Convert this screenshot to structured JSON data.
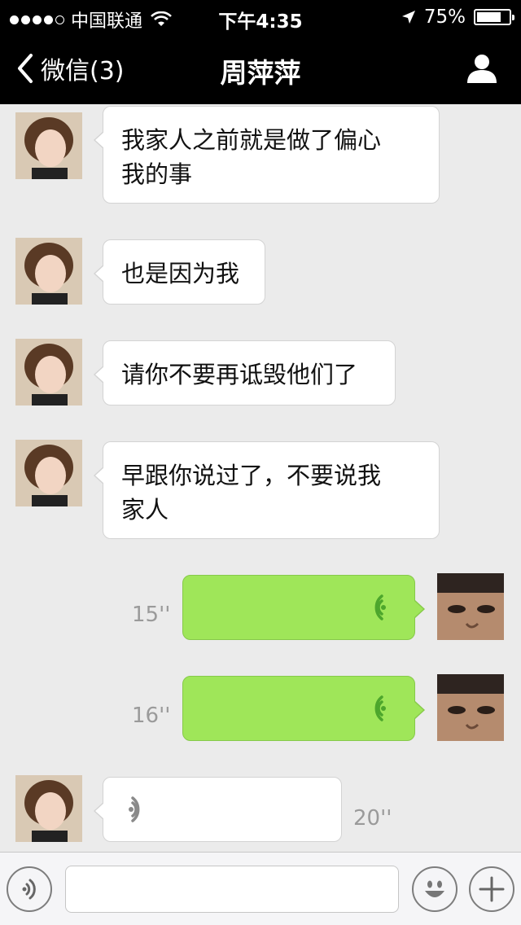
{
  "status_bar": {
    "carrier": "中国联通",
    "time": "下午4:35",
    "battery": "75%",
    "battery_level": 0.75
  },
  "nav": {
    "back_label": "微信(3)",
    "title": "周萍萍",
    "profile_icon": "person-icon"
  },
  "messages": [
    {
      "sender": "contact",
      "type": "text",
      "lines": [
        "我家人之前就是做了偏心",
        "我的事"
      ]
    },
    {
      "sender": "contact",
      "type": "text",
      "lines": [
        "也是因为我"
      ]
    },
    {
      "sender": "contact",
      "type": "text",
      "lines": [
        "请你不要再诋毁他们了"
      ]
    },
    {
      "sender": "contact",
      "type": "text",
      "lines": [
        "早跟你说过了，不要说我",
        "家人"
      ]
    },
    {
      "sender": "me",
      "type": "voice",
      "duration": "15''"
    },
    {
      "sender": "me",
      "type": "voice",
      "duration": "16''"
    },
    {
      "sender": "contact",
      "type": "voice",
      "duration": "20''"
    }
  ],
  "input_bar": {
    "voice_icon": "voice-toggle-icon",
    "placeholder": "",
    "emoji_icon": "emoji-icon",
    "plus_icon": "plus-icon"
  },
  "colors": {
    "bar": "#000000",
    "background": "#ebebeb",
    "sent_bubble": "#9fe659",
    "voice_wave": "#4da62c"
  }
}
